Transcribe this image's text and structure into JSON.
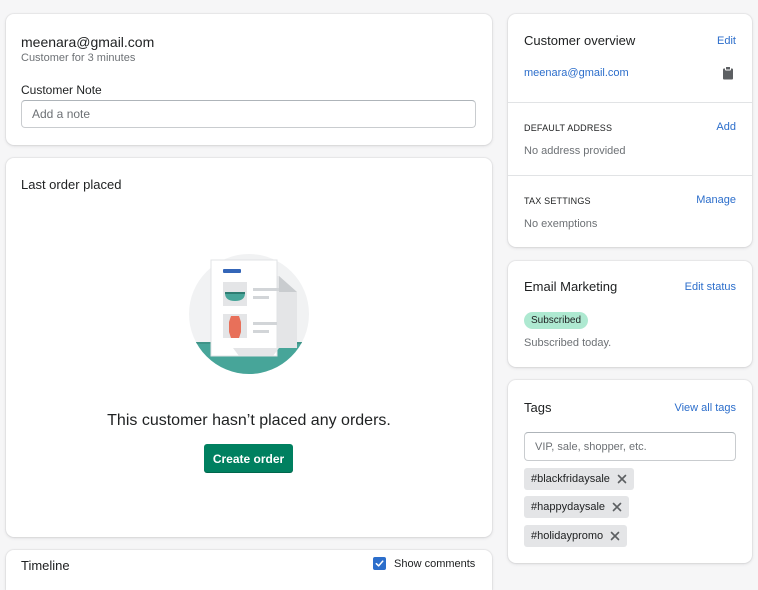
{
  "customer": {
    "email": "meenara@gmail.com",
    "since": "Customer for 3 minutes",
    "note_label": "Customer Note",
    "note_placeholder": "Add a note"
  },
  "last_order": {
    "title": "Last order placed",
    "empty_message": "This customer hasn’t placed any orders.",
    "create_order_label": "Create order"
  },
  "timeline": {
    "title": "Timeline",
    "show_comments_label": "Show comments",
    "show_comments_checked": true
  },
  "overview": {
    "title": "Customer overview",
    "edit_label": "Edit",
    "email": "meenara@gmail.com",
    "copy_icon": "clipboard-icon",
    "address_heading": "DEFAULT ADDRESS",
    "address_action": "Add",
    "address_value": "No address provided",
    "tax_heading": "TAX SETTINGS",
    "tax_action": "Manage",
    "tax_value": "No exemptions"
  },
  "email_marketing": {
    "title": "Email Marketing",
    "edit_label": "Edit status",
    "status_badge": "Subscribed",
    "status_note": "Subscribed today."
  },
  "tags": {
    "title": "Tags",
    "view_all_label": "View all tags",
    "placeholder": "VIP, sale, shopper, etc.",
    "items": [
      {
        "label": "#blackfridaysale"
      },
      {
        "label": "#happydaysale"
      },
      {
        "label": "#holidaypromo"
      }
    ]
  },
  "colors": {
    "primary_button": "#008060",
    "link": "#2c6ecb",
    "badge_success": "#aee9d1",
    "illustration_teal": "#47a599"
  }
}
